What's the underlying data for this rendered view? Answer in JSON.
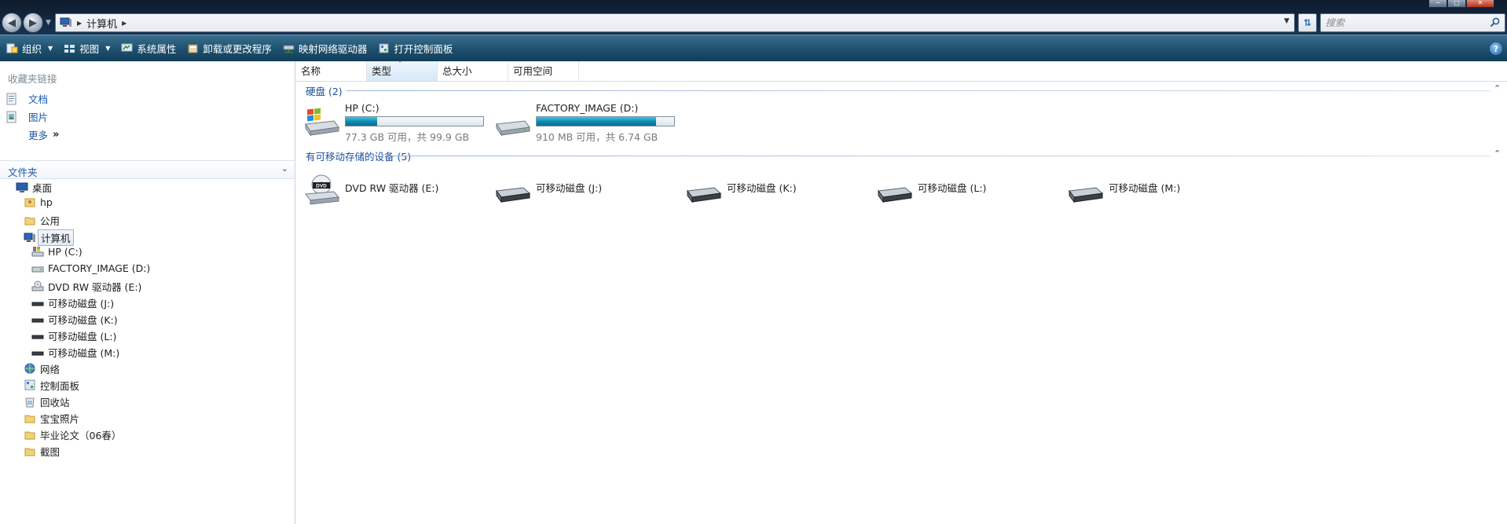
{
  "address": {
    "breadcrumb": "计算机",
    "search_placeholder": "搜索"
  },
  "toolbar": {
    "organize": "组织",
    "views": "视图",
    "system_properties": "系统属性",
    "uninstall": "卸载或更改程序",
    "map_drive": "映射网络驱动器",
    "control_panel": "打开控制面板"
  },
  "navpane": {
    "favorites_header": "收藏夹链接",
    "favorites": [
      {
        "label": "文档",
        "icon": "document-icon"
      },
      {
        "label": "图片",
        "icon": "pictures-icon"
      }
    ],
    "more": "更多",
    "folders_header": "文件夹",
    "tree": [
      {
        "label": "桌面",
        "icon": "desktop-icon"
      },
      {
        "label": "hp",
        "icon": "user-folder-icon"
      },
      {
        "label": "公用",
        "icon": "folder-icon"
      },
      {
        "label": "计算机",
        "icon": "computer-icon"
      },
      {
        "label": "HP (C:)",
        "icon": "windows-drive-icon"
      },
      {
        "label": "FACTORY_IMAGE (D:)",
        "icon": "hard-drive-icon"
      },
      {
        "label": "DVD RW 驱动器 (E:)",
        "icon": "dvd-drive-icon"
      },
      {
        "label": "可移动磁盘 (J:)",
        "icon": "removable-drive-icon"
      },
      {
        "label": "可移动磁盘 (K:)",
        "icon": "removable-drive-icon"
      },
      {
        "label": "可移动磁盘 (L:)",
        "icon": "removable-drive-icon"
      },
      {
        "label": "可移动磁盘 (M:)",
        "icon": "removable-drive-icon"
      },
      {
        "label": "网络",
        "icon": "network-icon"
      },
      {
        "label": "控制面板",
        "icon": "control-panel-icon"
      },
      {
        "label": "回收站",
        "icon": "recycle-bin-icon"
      },
      {
        "label": "宝宝照片",
        "icon": "folder-icon"
      },
      {
        "label": "毕业论文（06春）",
        "icon": "folder-icon"
      },
      {
        "label": "截图",
        "icon": "folder-icon"
      }
    ]
  },
  "columns": [
    "名称",
    "类型",
    "总大小",
    "可用空间"
  ],
  "groups": {
    "hard_disks": "硬盘 (2)",
    "removable": "有可移动存储的设备 (5)"
  },
  "drives": [
    {
      "name": "HP (C:)",
      "free_text": "77.3 GB 可用，共 99.9 GB",
      "used_fraction": 0.226
    },
    {
      "name": "FACTORY_IMAGE (D:)",
      "free_text": "910 MB 可用，共 6.74 GB",
      "used_fraction": 0.868
    }
  ],
  "removable": [
    {
      "name": "DVD RW 驱动器 (E:)",
      "icon": "dvd-drive-icon"
    },
    {
      "name": "可移动磁盘 (J:)",
      "icon": "removable-drive-icon"
    },
    {
      "name": "可移动磁盘 (K:)",
      "icon": "removable-drive-icon"
    },
    {
      "name": "可移动磁盘 (L:)",
      "icon": "removable-drive-icon"
    },
    {
      "name": "可移动磁盘 (M:)",
      "icon": "removable-drive-icon"
    }
  ],
  "colors": {
    "link_blue": "#1b57a8",
    "usage_bar": "#1698bd"
  }
}
